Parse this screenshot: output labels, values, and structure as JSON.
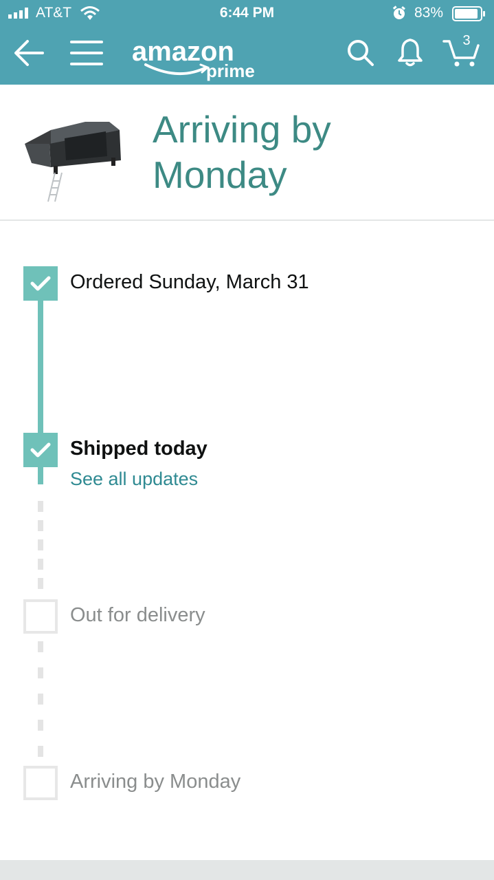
{
  "status_bar": {
    "carrier": "AT&T",
    "time": "6:44 PM",
    "battery": "83%"
  },
  "nav": {
    "logo_main": "amazon",
    "logo_sub": "prime",
    "cart_count": "3"
  },
  "product": {
    "title": "Arriving by Monday"
  },
  "steps": [
    {
      "label": "Ordered Sunday, March 31",
      "state": "done"
    },
    {
      "label": "Shipped today",
      "state": "done",
      "link": "See all updates"
    },
    {
      "label": "Out for delivery",
      "state": "pending"
    },
    {
      "label": "Arriving by Monday",
      "state": "pending"
    }
  ],
  "colors": {
    "header": "#4fa3b2",
    "accent": "#6fc1b9",
    "title": "#3d8a84",
    "link": "#2f8a92"
  }
}
